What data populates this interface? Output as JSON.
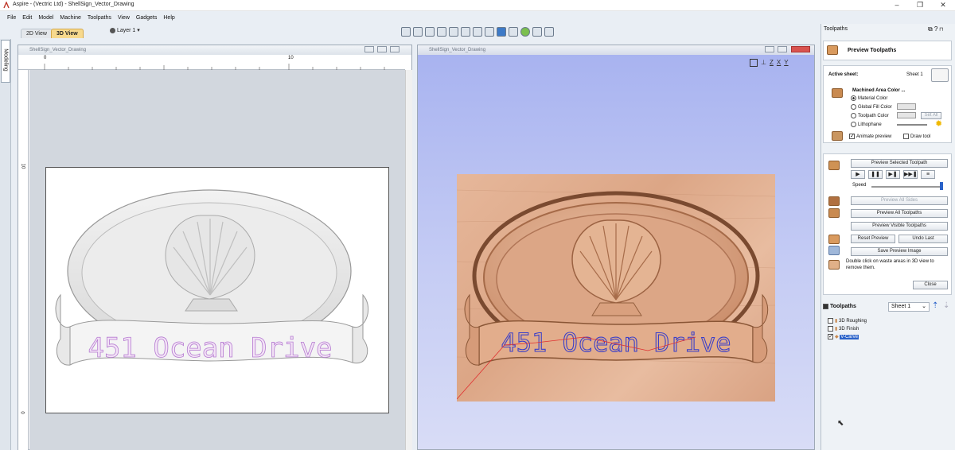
{
  "window": {
    "title": "Aspire - (Vectric Ltd) - ShellSign_Vector_Drawing",
    "minimize": "–",
    "restore": "❐",
    "close": "✕"
  },
  "menu": [
    "File",
    "Edit",
    "Model",
    "Machine",
    "Toolpaths",
    "View",
    "Gadgets",
    "Help"
  ],
  "view_tabs": {
    "tab_2d": "2D View",
    "tab_3d": "3D View"
  },
  "layer": {
    "label": "Layer 1",
    "arrow": "▾"
  },
  "left_strip": {
    "modeling_label": "Modeling"
  },
  "panel_2d": {
    "title": "ShellSign_Vector_Drawing",
    "ruler_top_0": "0",
    "ruler_top_10": "10",
    "ruler_left_10": "10",
    "ruler_left_0": "0",
    "sign_text": "451 Ocean Drive"
  },
  "panel_3d": {
    "title": "ShellSign_Vector_Drawing",
    "sign_text": "451 Ocean Drive",
    "view_axes": [
      "Z",
      "X",
      "Y"
    ]
  },
  "right_pane": {
    "title": "Toolpaths",
    "header_title": "Preview Toolpaths",
    "active_sheet_label": "Active sheet:",
    "active_sheet_value": "Sheet 1",
    "machined_color_label": "Machined Area Color ...",
    "radio_material": "Material Color",
    "radio_global": "Global Fill Color",
    "radio_toolpath": "Toolpath Color",
    "radio_lithophane": "Lithophane",
    "set_all": "Set All",
    "animate_preview": "Animate preview",
    "draw_tool": "Draw tool",
    "preview_selected": "Preview Selected Toolpath",
    "speed_label": "Speed",
    "preview_all_sides": "Preview All Sides",
    "preview_all_toolpaths": "Preview All Toolpaths",
    "preview_visible": "Preview Visible Toolpaths",
    "reset_preview": "Reset Preview",
    "undo_last": "Undo Last",
    "save_image": "Save Preview Image",
    "hint": "Double click on waste areas in 3D view to remove them.",
    "close": "Close",
    "toolpaths_list_title": "Toolpaths",
    "sheet_select": "Sheet 1",
    "toolpaths": [
      {
        "name": "3D Roughing",
        "checked": false
      },
      {
        "name": "3D Finish",
        "checked": false
      },
      {
        "name": "V-Carve",
        "checked": true
      }
    ]
  },
  "colors": {
    "accent_tab": "#f7d98d",
    "view3d_bg": "#a7b2f0",
    "wood": "#dca686",
    "vector_purple": "#b57bd1",
    "toolpath_blue": "#3a3fc9"
  }
}
